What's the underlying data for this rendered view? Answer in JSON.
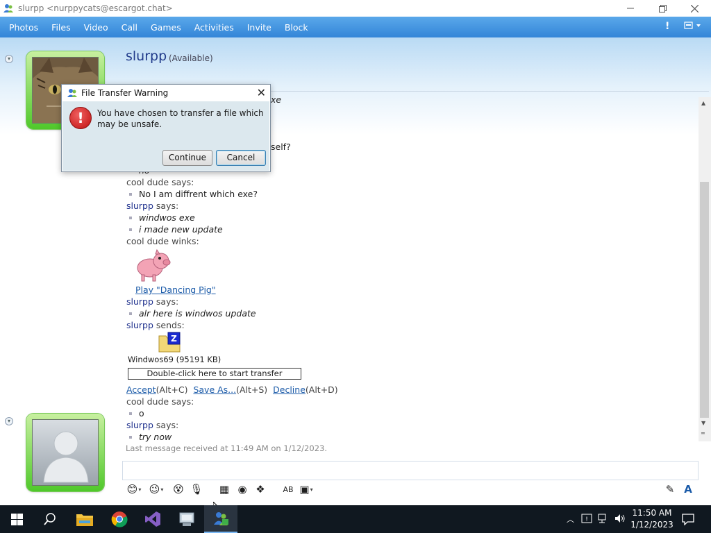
{
  "window": {
    "title": "slurpp <nurppycats@escargot.chat>"
  },
  "menu": [
    "Photos",
    "Files",
    "Video",
    "Call",
    "Games",
    "Activities",
    "Invite",
    "Block"
  ],
  "contact": {
    "name": "slurpp",
    "status": "(Available)"
  },
  "conversation": {
    "partial_exe": "xe",
    "partial_self": "self?",
    "partial_no": "no",
    "l1_who": "cool dude",
    "l1_verb": "says:",
    "l1_msg": "No I am diffrent which exe?",
    "l2_who": "slurpp",
    "l2_verb": "says:",
    "l2_msg1": "windwos exe",
    "l2_msg2": "i made new update",
    "l3_who": "cool dude",
    "l3_verb": "winks:",
    "wink_link": "Play \"Dancing Pig\"",
    "l4_who": "slurpp",
    "l4_verb": "says:",
    "l4_msg": "alr here is windwos update",
    "l5_who": "slurpp",
    "l5_verb": "sends:",
    "file_name": "Windwos69 (95191 KB)",
    "file_action": "Double-click here to start transfer",
    "accept": "Accept",
    "accept_key": "(Alt+C)",
    "saveas": "Save As...",
    "saveas_key": "(Alt+S)",
    "decline": "Decline",
    "decline_key": "(Alt+D)",
    "l6_who": "cool dude",
    "l6_verb": "says:",
    "l6_msg": "o",
    "l7_who": "slurpp",
    "l7_verb": "says:",
    "l7_msg": "try now",
    "last_received": "Last message received at 11:49 AM on 1/12/2023."
  },
  "dialog": {
    "title": "File Transfer Warning",
    "message": "You have chosen to transfer a file which may be unsafe.",
    "continue": "Continue",
    "cancel": "Cancel"
  },
  "taskbar": {
    "time": "11:50 AM",
    "date": "1/12/2023"
  },
  "colors": {
    "menubar": "#3a8ddc",
    "name": "#203a8a",
    "link": "#1a5aa8",
    "avatar_green": "#4fc82a"
  }
}
